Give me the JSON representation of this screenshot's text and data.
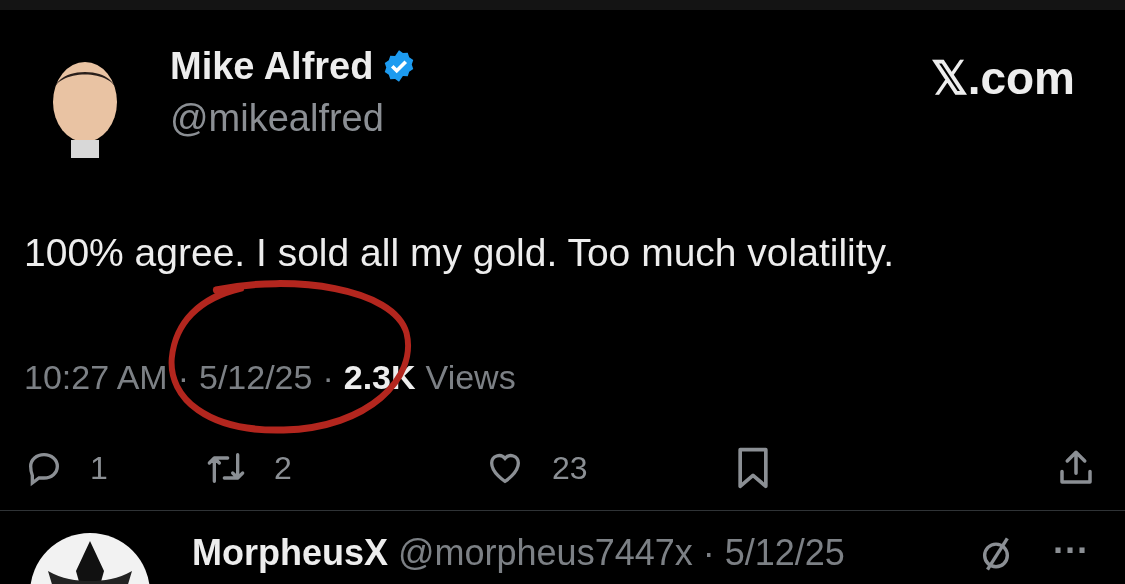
{
  "tweet": {
    "author": {
      "name": "Mike Alfred",
      "verified": true,
      "handle": "@mikealfred"
    },
    "site_logo": "𝕏.com",
    "text": "100% agree. I sold all my gold. Too much volatility.",
    "time": "10:27 AM",
    "date": "5/12/25",
    "views_count": "2.3K",
    "views_label": "Views",
    "separator": "·",
    "actions": [
      {
        "kind": "reply",
        "count": "1"
      },
      {
        "kind": "repost",
        "count": "2"
      },
      {
        "kind": "like",
        "count": "23"
      },
      {
        "kind": "bookmark"
      },
      {
        "kind": "share"
      }
    ],
    "annotation": {
      "kind": "hand-drawn-circle",
      "color": "#b3261e"
    }
  },
  "next_reply": {
    "name": "MorpheusX",
    "handle": "@morpheus7447x",
    "separator": "·",
    "date": "5/12/25",
    "more": "···"
  }
}
